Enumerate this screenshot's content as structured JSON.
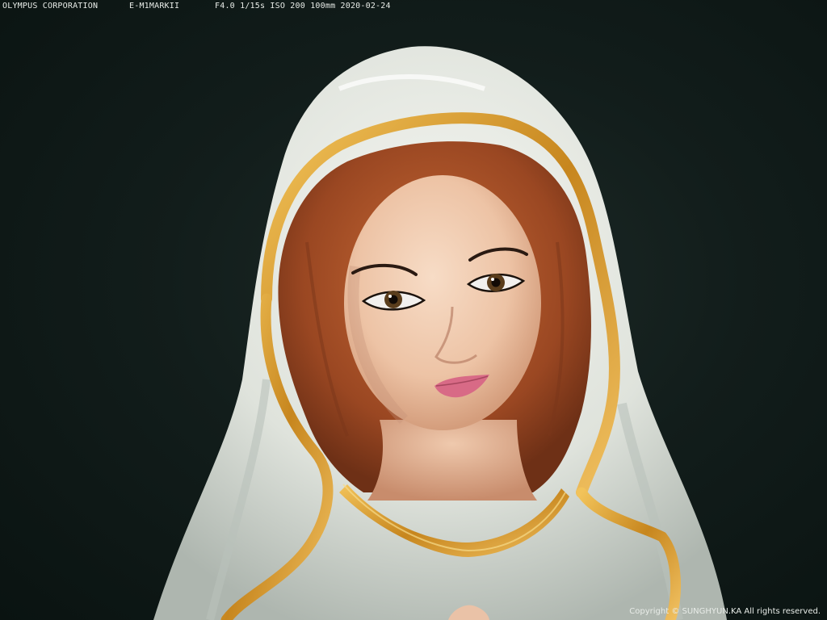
{
  "exif": {
    "maker": "OLYMPUS CORPORATION",
    "model": "E-M1MARKII",
    "settings": "F4.0  1/15s ISO 200 100mm 2020-02-24"
  },
  "watermark": {
    "copyright": "Copyright © SUNGHYUN.KA All rights reserved."
  },
  "palette": {
    "background": "#0e1917",
    "veil": "#e9ece6",
    "gold_trim": "#d69a2a",
    "hair": "#a8532a",
    "skin": "#f0c9ae",
    "lips": "#d86a86"
  }
}
